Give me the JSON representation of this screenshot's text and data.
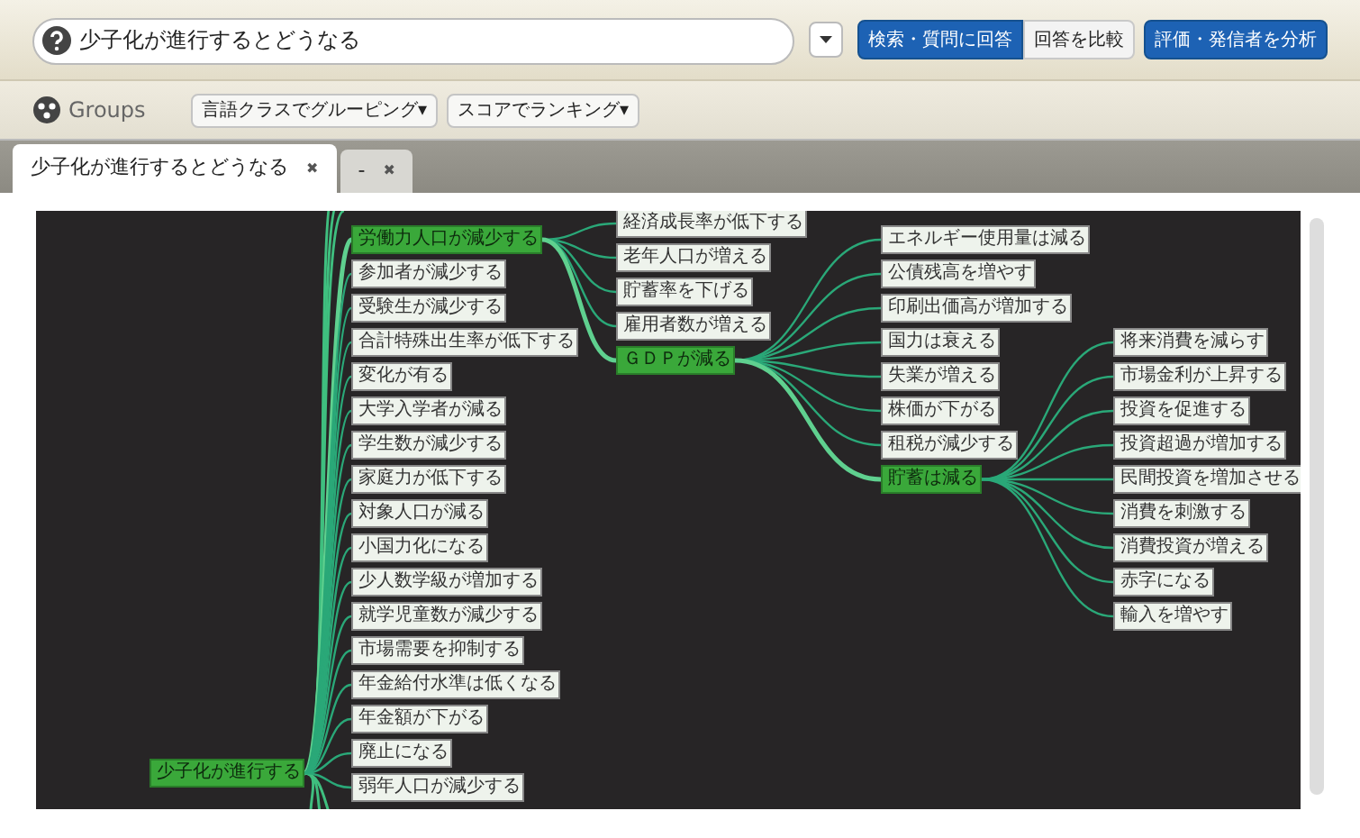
{
  "search": {
    "value": "少子化が進行するとどうなる"
  },
  "buttons": [
    {
      "label": "検索・質問に回答",
      "kind": "primary"
    },
    {
      "label": "回答を比較",
      "kind": "plain"
    },
    {
      "label": "評価・発信者を分析",
      "kind": "primary"
    }
  ],
  "toolbar": {
    "title": "Groups",
    "menus": [
      "言語クラスでグルーピング▾",
      "スコアでランキング▾"
    ]
  },
  "tabs": [
    {
      "label": "少子化が進行するとどうなる",
      "close": "✖",
      "selected": true
    },
    {
      "label": "-",
      "close": "✖",
      "selected": false
    }
  ],
  "tree": {
    "label": "少子化が進行する",
    "highlighted": true,
    "children": [
      {
        "label": "労働力人口が減少する",
        "highlighted": true,
        "children": [
          {
            "label": "経済成長率が低下する",
            "highlighted": false
          },
          {
            "label": "老年人口が増える",
            "highlighted": false
          },
          {
            "label": "貯蓄率を下げる",
            "highlighted": false
          },
          {
            "label": "雇用者数が増える",
            "highlighted": false
          },
          {
            "label": "ＧＤＰが減る",
            "highlighted": true,
            "children": [
              {
                "label": "エネルギー使用量は減る",
                "highlighted": false
              },
              {
                "label": "公債残高を増やす",
                "highlighted": false
              },
              {
                "label": "印刷出価高が増加する",
                "highlighted": false
              },
              {
                "label": "国力は衰える",
                "highlighted": false
              },
              {
                "label": "失業が増える",
                "highlighted": false
              },
              {
                "label": "株価が下がる",
                "highlighted": false
              },
              {
                "label": "租税が減少する",
                "highlighted": false
              },
              {
                "label": "貯蓄は減る",
                "highlighted": true,
                "children": [
                  {
                    "label": "将来消費を減らす",
                    "highlighted": false
                  },
                  {
                    "label": "市場金利が上昇する",
                    "highlighted": false
                  },
                  {
                    "label": "投資を促進する",
                    "highlighted": false
                  },
                  {
                    "label": "投資超過が増加する",
                    "highlighted": false
                  },
                  {
                    "label": "民間投資を増加させる",
                    "highlighted": false
                  },
                  {
                    "label": "消費を刺激する",
                    "highlighted": false
                  },
                  {
                    "label": "消費投資が増える",
                    "highlighted": false
                  },
                  {
                    "label": "赤字になる",
                    "highlighted": false
                  },
                  {
                    "label": "輸入を増やす",
                    "highlighted": false
                  }
                ]
              }
            ]
          }
        ]
      },
      {
        "label": "参加者が減少する",
        "highlighted": false
      },
      {
        "label": "受験生が減少する",
        "highlighted": false
      },
      {
        "label": "合計特殊出生率が低下する",
        "highlighted": false
      },
      {
        "label": "変化が有る",
        "highlighted": false
      },
      {
        "label": "大学入学者が減る",
        "highlighted": false
      },
      {
        "label": "学生数が減少する",
        "highlighted": false
      },
      {
        "label": "家庭力が低下する",
        "highlighted": false
      },
      {
        "label": "対象人口が減る",
        "highlighted": false
      },
      {
        "label": "小国力化になる",
        "highlighted": false
      },
      {
        "label": "少人数学級が増加する",
        "highlighted": false
      },
      {
        "label": "就学児童数が減少する",
        "highlighted": false
      },
      {
        "label": "市場需要を抑制する",
        "highlighted": false
      },
      {
        "label": "年金給付水準は低くなる",
        "highlighted": false
      },
      {
        "label": "年金額が下がる",
        "highlighted": false
      },
      {
        "label": "廃止になる",
        "highlighted": false
      },
      {
        "label": "弱年人口が減少する",
        "highlighted": false
      }
    ]
  }
}
